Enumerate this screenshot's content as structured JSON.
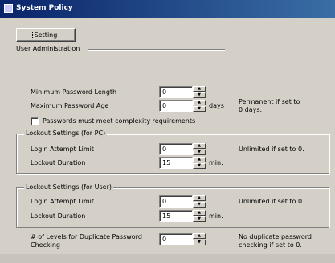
{
  "window": {
    "title": "System Policy"
  },
  "setting_button": "Setting",
  "user_admin_label": "User Administration",
  "min_password_length": {
    "label": "Minimum Password Length",
    "value": "0"
  },
  "max_password_age": {
    "label": "Maximum Password Age",
    "value": "0",
    "unit": "days",
    "note_line1": "Permanent if set to",
    "note_line2": "0 days."
  },
  "complexity": {
    "label": "Passwords must meet complexity requirements",
    "checked": false
  },
  "lockout_pc": {
    "legend": "Lockout Settings (for PC)",
    "attempt_label": "Login Attempt Limit",
    "attempt_value": "0",
    "attempt_note": "Unlimited if set to 0.",
    "duration_label": "Lockout Duration",
    "duration_value": "15",
    "duration_unit": "min."
  },
  "lockout_user": {
    "legend": "Lockout Settings (for User)",
    "attempt_label": "Login Attempt Limit",
    "attempt_value": "0",
    "attempt_note": "Unlimited if set to 0.",
    "duration_label": "Lockout Duration",
    "duration_value": "15",
    "duration_unit": "min."
  },
  "duplicate": {
    "label_line1": "# of Levels for Duplicate Password",
    "label_line2": "Checking",
    "value": "0",
    "note_line1": "No duplicate password",
    "note_line2": "checking if set to 0."
  },
  "icons": {
    "window": "window-icon",
    "spin_up": "spin-up-icon",
    "spin_down": "spin-down-icon"
  }
}
